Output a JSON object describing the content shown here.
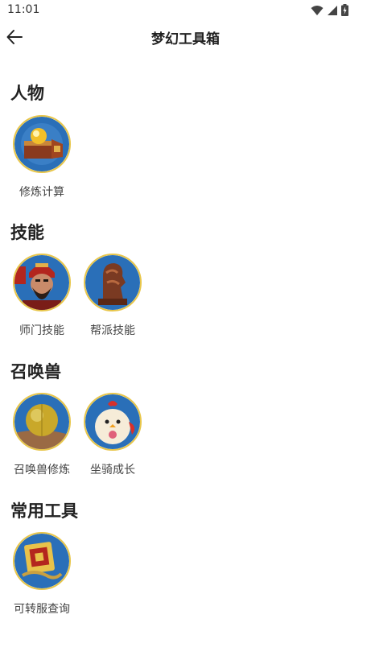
{
  "status_bar": {
    "time": "11:01"
  },
  "header": {
    "title": "梦幻工具箱"
  },
  "sections": [
    {
      "title": "人物",
      "items": [
        {
          "label": "修炼计算"
        }
      ]
    },
    {
      "title": "技能",
      "items": [
        {
          "label": "师门技能"
        },
        {
          "label": "帮派技能"
        }
      ]
    },
    {
      "title": "召唤兽",
      "items": [
        {
          "label": "召唤兽修炼"
        },
        {
          "label": "坐骑成长"
        }
      ]
    },
    {
      "title": "常用工具",
      "items": [
        {
          "label": "可转服查询"
        }
      ]
    }
  ]
}
